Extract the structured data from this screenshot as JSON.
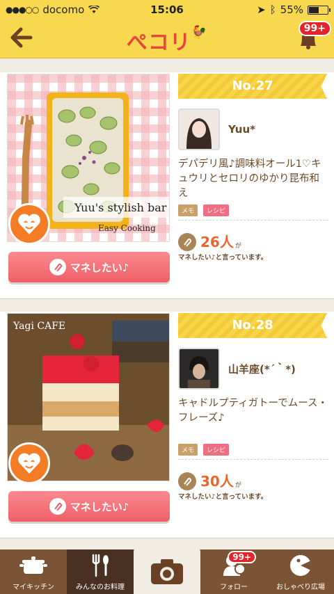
{
  "status": {
    "carrier": "docomo",
    "time": "15:06",
    "battery": "55%",
    "battery_level": 0.55
  },
  "nav": {
    "logo": "ぺコリ",
    "notification_badge": "99+"
  },
  "posts": [
    {
      "rank": "No.27",
      "username": "Yuu*",
      "description": "デパデリ風♪調味料オール1♡キュウリとセロリのゆかり昆布和え",
      "tag_memo": "メモ",
      "tag_recipe": "レシピ",
      "count": "26人",
      "count_suffix": "が",
      "count_note": "マネしたい♪と言っています。",
      "button": "マネしたい♪",
      "photo_caption": "Yuu's stylish bar",
      "photo_subcaption": "Easy Cooking"
    },
    {
      "rank": "No.28",
      "username": "山羊座(*´｀*)",
      "description": "キャドルプティガトーでムース・フレーズ♪",
      "tag_memo": "メモ",
      "tag_recipe": "レシピ",
      "count": "30人",
      "count_suffix": "が",
      "count_note": "マネしたい♪と言っています。",
      "button": "マネしたい♪",
      "photo_caption": "Yagi CAFE"
    }
  ],
  "tabs": [
    {
      "label": "マイキッチン",
      "icon": "pot-icon"
    },
    {
      "label": "みんなのお料理",
      "icon": "fork-spoon-icon"
    },
    {
      "label": "",
      "icon": "camera-icon"
    },
    {
      "label": "フォロー",
      "icon": "follow-icon",
      "badge": "99+"
    },
    {
      "label": "おしゃべり広場",
      "icon": "chat-icon"
    }
  ],
  "colors": {
    "header": "#f7d84e",
    "accent": "#e8473a",
    "button": "#ef5f67",
    "tabbar": "#7a5434"
  }
}
